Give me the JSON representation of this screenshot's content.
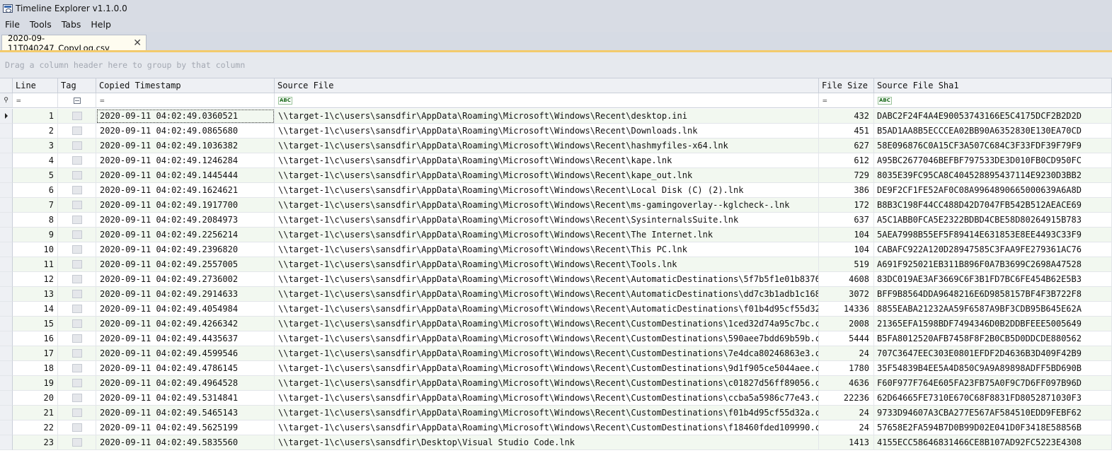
{
  "window": {
    "title": "Timeline Explorer v1.1.0.0"
  },
  "menu": [
    "File",
    "Tools",
    "Tabs",
    "Help"
  ],
  "tab": {
    "label": "2020-09-11T040247_CopyLog.csv",
    "close": "✕"
  },
  "group_panel": {
    "hint": "Drag a column header here to group by that column"
  },
  "columns": {
    "line": "Line",
    "tag": "Tag",
    "copied_timestamp": "Copied Timestamp",
    "source_file": "Source File",
    "file_size": "File Size",
    "source_file_sha1": "Source File Sha1"
  },
  "filter": {
    "equals": "=",
    "contains": "ABC"
  },
  "selected_row": 1,
  "rows": [
    {
      "line": "1",
      "ts": "2020-09-11 04:02:49.0360521",
      "src": "\\\\target-1\\c\\users\\sansdfir\\AppData\\Roaming\\Microsoft\\Windows\\Recent\\desktop.ini",
      "size": "432",
      "sha1": "DABC2F24F4A4E90053743166E5C4175DCF2B2D2D"
    },
    {
      "line": "2",
      "ts": "2020-09-11 04:02:49.0865680",
      "src": "\\\\target-1\\c\\users\\sansdfir\\AppData\\Roaming\\Microsoft\\Windows\\Recent\\Downloads.lnk",
      "size": "451",
      "sha1": "B5AD1AA8B5ECCCEA02BB90A6352830E130EA70CD"
    },
    {
      "line": "3",
      "ts": "2020-09-11 04:02:49.1036382",
      "src": "\\\\target-1\\c\\users\\sansdfir\\AppData\\Roaming\\Microsoft\\Windows\\Recent\\hashmyfiles-x64.lnk",
      "size": "627",
      "sha1": "58E096876C0A15CF3A507C684C3F33FDF39F79F9"
    },
    {
      "line": "4",
      "ts": "2020-09-11 04:02:49.1246284",
      "src": "\\\\target-1\\c\\users\\sansdfir\\AppData\\Roaming\\Microsoft\\Windows\\Recent\\kape.lnk",
      "size": "612",
      "sha1": "A95BC2677046BEFBF797533DE3D010FB0CD950FC"
    },
    {
      "line": "5",
      "ts": "2020-09-11 04:02:49.1445444",
      "src": "\\\\target-1\\c\\users\\sansdfir\\AppData\\Roaming\\Microsoft\\Windows\\Recent\\kape_out.lnk",
      "size": "729",
      "sha1": "8035E39FC95CA8C404528895437114E9230D3BB2"
    },
    {
      "line": "6",
      "ts": "2020-09-11 04:02:49.1624621",
      "src": "\\\\target-1\\c\\users\\sansdfir\\AppData\\Roaming\\Microsoft\\Windows\\Recent\\Local Disk (C) (2).lnk",
      "size": "386",
      "sha1": "DE9F2CF1FE52AF0C08A9964890665000639A6A8D"
    },
    {
      "line": "7",
      "ts": "2020-09-11 04:02:49.1917700",
      "src": "\\\\target-1\\c\\users\\sansdfir\\AppData\\Roaming\\Microsoft\\Windows\\Recent\\ms-gamingoverlay--kglcheck-.lnk",
      "size": "172",
      "sha1": "B8B3C198F44CC488D42D7047FB542B512AEACE69"
    },
    {
      "line": "8",
      "ts": "2020-09-11 04:02:49.2084973",
      "src": "\\\\target-1\\c\\users\\sansdfir\\AppData\\Roaming\\Microsoft\\Windows\\Recent\\SysinternalsSuite.lnk",
      "size": "637",
      "sha1": "A5C1ABB0FCA5E2322BDBD4CBE58D80264915B783"
    },
    {
      "line": "9",
      "ts": "2020-09-11 04:02:49.2256214",
      "src": "\\\\target-1\\c\\users\\sansdfir\\AppData\\Roaming\\Microsoft\\Windows\\Recent\\The Internet.lnk",
      "size": "104",
      "sha1": "5AEA7998B55EF5F89414E631853E8EE4493C33F9"
    },
    {
      "line": "10",
      "ts": "2020-09-11 04:02:49.2396820",
      "src": "\\\\target-1\\c\\users\\sansdfir\\AppData\\Roaming\\Microsoft\\Windows\\Recent\\This PC.lnk",
      "size": "104",
      "sha1": "CABAFC922A120D28947585C3FAA9FE279361AC76"
    },
    {
      "line": "11",
      "ts": "2020-09-11 04:02:49.2557005",
      "src": "\\\\target-1\\c\\users\\sansdfir\\AppData\\Roaming\\Microsoft\\Windows\\Recent\\Tools.lnk",
      "size": "519",
      "sha1": "A691F925021EB311B896F0A7B3699C2698A47528"
    },
    {
      "line": "12",
      "ts": "2020-09-11 04:02:49.2736002",
      "src": "\\\\target-1\\c\\users\\sansdfir\\AppData\\Roaming\\Microsoft\\Windows\\Recent\\AutomaticDestinations\\5f7b5f1e01b83767...",
      "size": "4608",
      "sha1": "83DC019AE3AF3669C6F3B1FD7BC6FE454B62E5B3"
    },
    {
      "line": "13",
      "ts": "2020-09-11 04:02:49.2914633",
      "src": "\\\\target-1\\c\\users\\sansdfir\\AppData\\Roaming\\Microsoft\\Windows\\Recent\\AutomaticDestinations\\dd7c3b1adb1c168b...",
      "size": "3072",
      "sha1": "BFF9B8564DDA9648216E6D9858157BF4F3B722F8"
    },
    {
      "line": "14",
      "ts": "2020-09-11 04:02:49.4054984",
      "src": "\\\\target-1\\c\\users\\sansdfir\\AppData\\Roaming\\Microsoft\\Windows\\Recent\\AutomaticDestinations\\f01b4d95cf55d32a...",
      "size": "14336",
      "sha1": "8855EABA21232AA59F6587A9BF3CDB95B645E62A"
    },
    {
      "line": "15",
      "ts": "2020-09-11 04:02:49.4266342",
      "src": "\\\\target-1\\c\\users\\sansdfir\\AppData\\Roaming\\Microsoft\\Windows\\Recent\\CustomDestinations\\1ced32d74a95c7bc.cu...",
      "size": "2008",
      "sha1": "21365EFA1598BDF7494346D0B2DDBFEEE5005649"
    },
    {
      "line": "16",
      "ts": "2020-09-11 04:02:49.4435637",
      "src": "\\\\target-1\\c\\users\\sansdfir\\AppData\\Roaming\\Microsoft\\Windows\\Recent\\CustomDestinations\\590aee7bdd69b59b.cu...",
      "size": "5444",
      "sha1": "B5FA8012520AFB7458F8F2B0CB5D0DDCDE880562"
    },
    {
      "line": "17",
      "ts": "2020-09-11 04:02:49.4599546",
      "src": "\\\\target-1\\c\\users\\sansdfir\\AppData\\Roaming\\Microsoft\\Windows\\Recent\\CustomDestinations\\7e4dca80246863e3.cu...",
      "size": "24",
      "sha1": "707C3647EEC303E0801EFDF2D4636B3D409F42B9"
    },
    {
      "line": "18",
      "ts": "2020-09-11 04:02:49.4786145",
      "src": "\\\\target-1\\c\\users\\sansdfir\\AppData\\Roaming\\Microsoft\\Windows\\Recent\\CustomDestinations\\9d1f905ce5044aee.cu...",
      "size": "1780",
      "sha1": "35F54839B4EE5A4D850C9A9A89898ADFF5BD690B"
    },
    {
      "line": "19",
      "ts": "2020-09-11 04:02:49.4964528",
      "src": "\\\\target-1\\c\\users\\sansdfir\\AppData\\Roaming\\Microsoft\\Windows\\Recent\\CustomDestinations\\c01827d56ff89056.cu...",
      "size": "4636",
      "sha1": "F60F977F764E605FA23FB75A0F9C7D6FF097B96D"
    },
    {
      "line": "20",
      "ts": "2020-09-11 04:02:49.5314841",
      "src": "\\\\target-1\\c\\users\\sansdfir\\AppData\\Roaming\\Microsoft\\Windows\\Recent\\CustomDestinations\\ccba5a5986c77e43.cu...",
      "size": "22236",
      "sha1": "62D64665FE7310E670C68F8831FD8052871030F3"
    },
    {
      "line": "21",
      "ts": "2020-09-11 04:02:49.5465143",
      "src": "\\\\target-1\\c\\users\\sansdfir\\AppData\\Roaming\\Microsoft\\Windows\\Recent\\CustomDestinations\\f01b4d95cf55d32a.cu...",
      "size": "24",
      "sha1": "9733D94607A3CBA277E567AF584510EDD9FEBF62"
    },
    {
      "line": "22",
      "ts": "2020-09-11 04:02:49.5625199",
      "src": "\\\\target-1\\c\\users\\sansdfir\\AppData\\Roaming\\Microsoft\\Windows\\Recent\\CustomDestinations\\f18460fded109990.cu...",
      "size": "24",
      "sha1": "57658E2FA594B7D0B99D02E041D0F3418E58856B"
    },
    {
      "line": "23",
      "ts": "2020-09-11 04:02:49.5835560",
      "src": "\\\\target-1\\c\\users\\sansdfir\\Desktop\\Visual Studio Code.lnk",
      "size": "1413",
      "sha1": "4155ECC58646831466CE8B107AD92FC5223E4308"
    }
  ]
}
